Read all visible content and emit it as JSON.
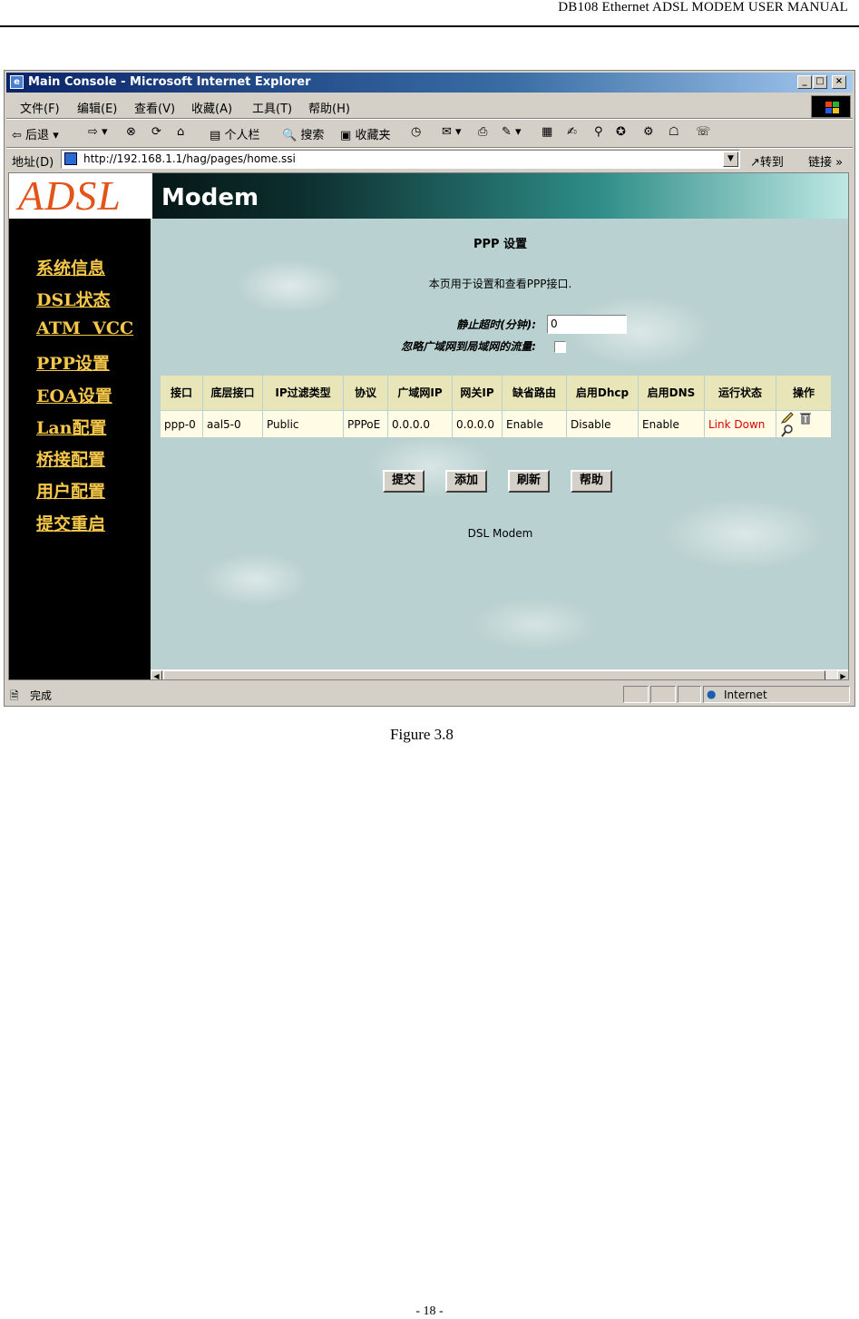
{
  "doc": {
    "header": "DB108  Ethernet  ADSL  MODEM  USER MANUAL",
    "caption": "Figure 3.8",
    "page_number": "- 18 -"
  },
  "browser": {
    "title": "Main Console - Microsoft Internet Explorer",
    "menu": [
      "文件(F)",
      "编辑(E)",
      "查看(V)",
      "收藏(A)",
      "工具(T)",
      "帮助(H)"
    ],
    "toolbar": {
      "back": "后退",
      "personal_bar": "个人栏",
      "search": "搜索",
      "favorites": "收藏夹"
    },
    "address_label": "地址(D)",
    "url": "http://192.168.1.1/hag/pages/home.ssi",
    "go": "转到",
    "links": "链接",
    "status_text": "完成",
    "zone": "Internet"
  },
  "banner": {
    "logo_left": "ADSL",
    "logo_right": "Modem"
  },
  "sidebar": {
    "items": [
      "系统信息",
      "DSL状态",
      "ATM  VCC",
      "PPP设置",
      "EOA设置",
      "Lan配置",
      "桥接配置",
      "用户配置",
      "提交重启"
    ]
  },
  "page": {
    "title": "PPP 设置",
    "description": "本页用于设置和查看PPP接口.",
    "idle_timeout_label": "静止超时(分钟):",
    "idle_timeout_value": "0",
    "ignore_wan_label": "忽略广域网到局域网的流量:",
    "ignore_wan_checked": false,
    "table": {
      "headers": [
        "接口",
        "底层接口",
        "IP过滤类型",
        "协议",
        "广域网IP",
        "网关IP",
        "缺省路由",
        "启用Dhcp",
        "启用DNS",
        "运行状态",
        "操作"
      ],
      "rows": [
        [
          "ppp-0",
          "aal5-0",
          "Public",
          "PPPoE",
          "0.0.0.0",
          "0.0.0.0",
          "Enable",
          "Disable",
          "Enable",
          "Link Down"
        ]
      ]
    },
    "buttons": {
      "submit": "提交",
      "add": "添加",
      "refresh": "刷新",
      "help": "帮助"
    },
    "footer": "DSL Modem"
  },
  "colors": {
    "sidebar_link": "#f6c84a",
    "status_down": "#e00000",
    "logo": "#e2541a"
  }
}
